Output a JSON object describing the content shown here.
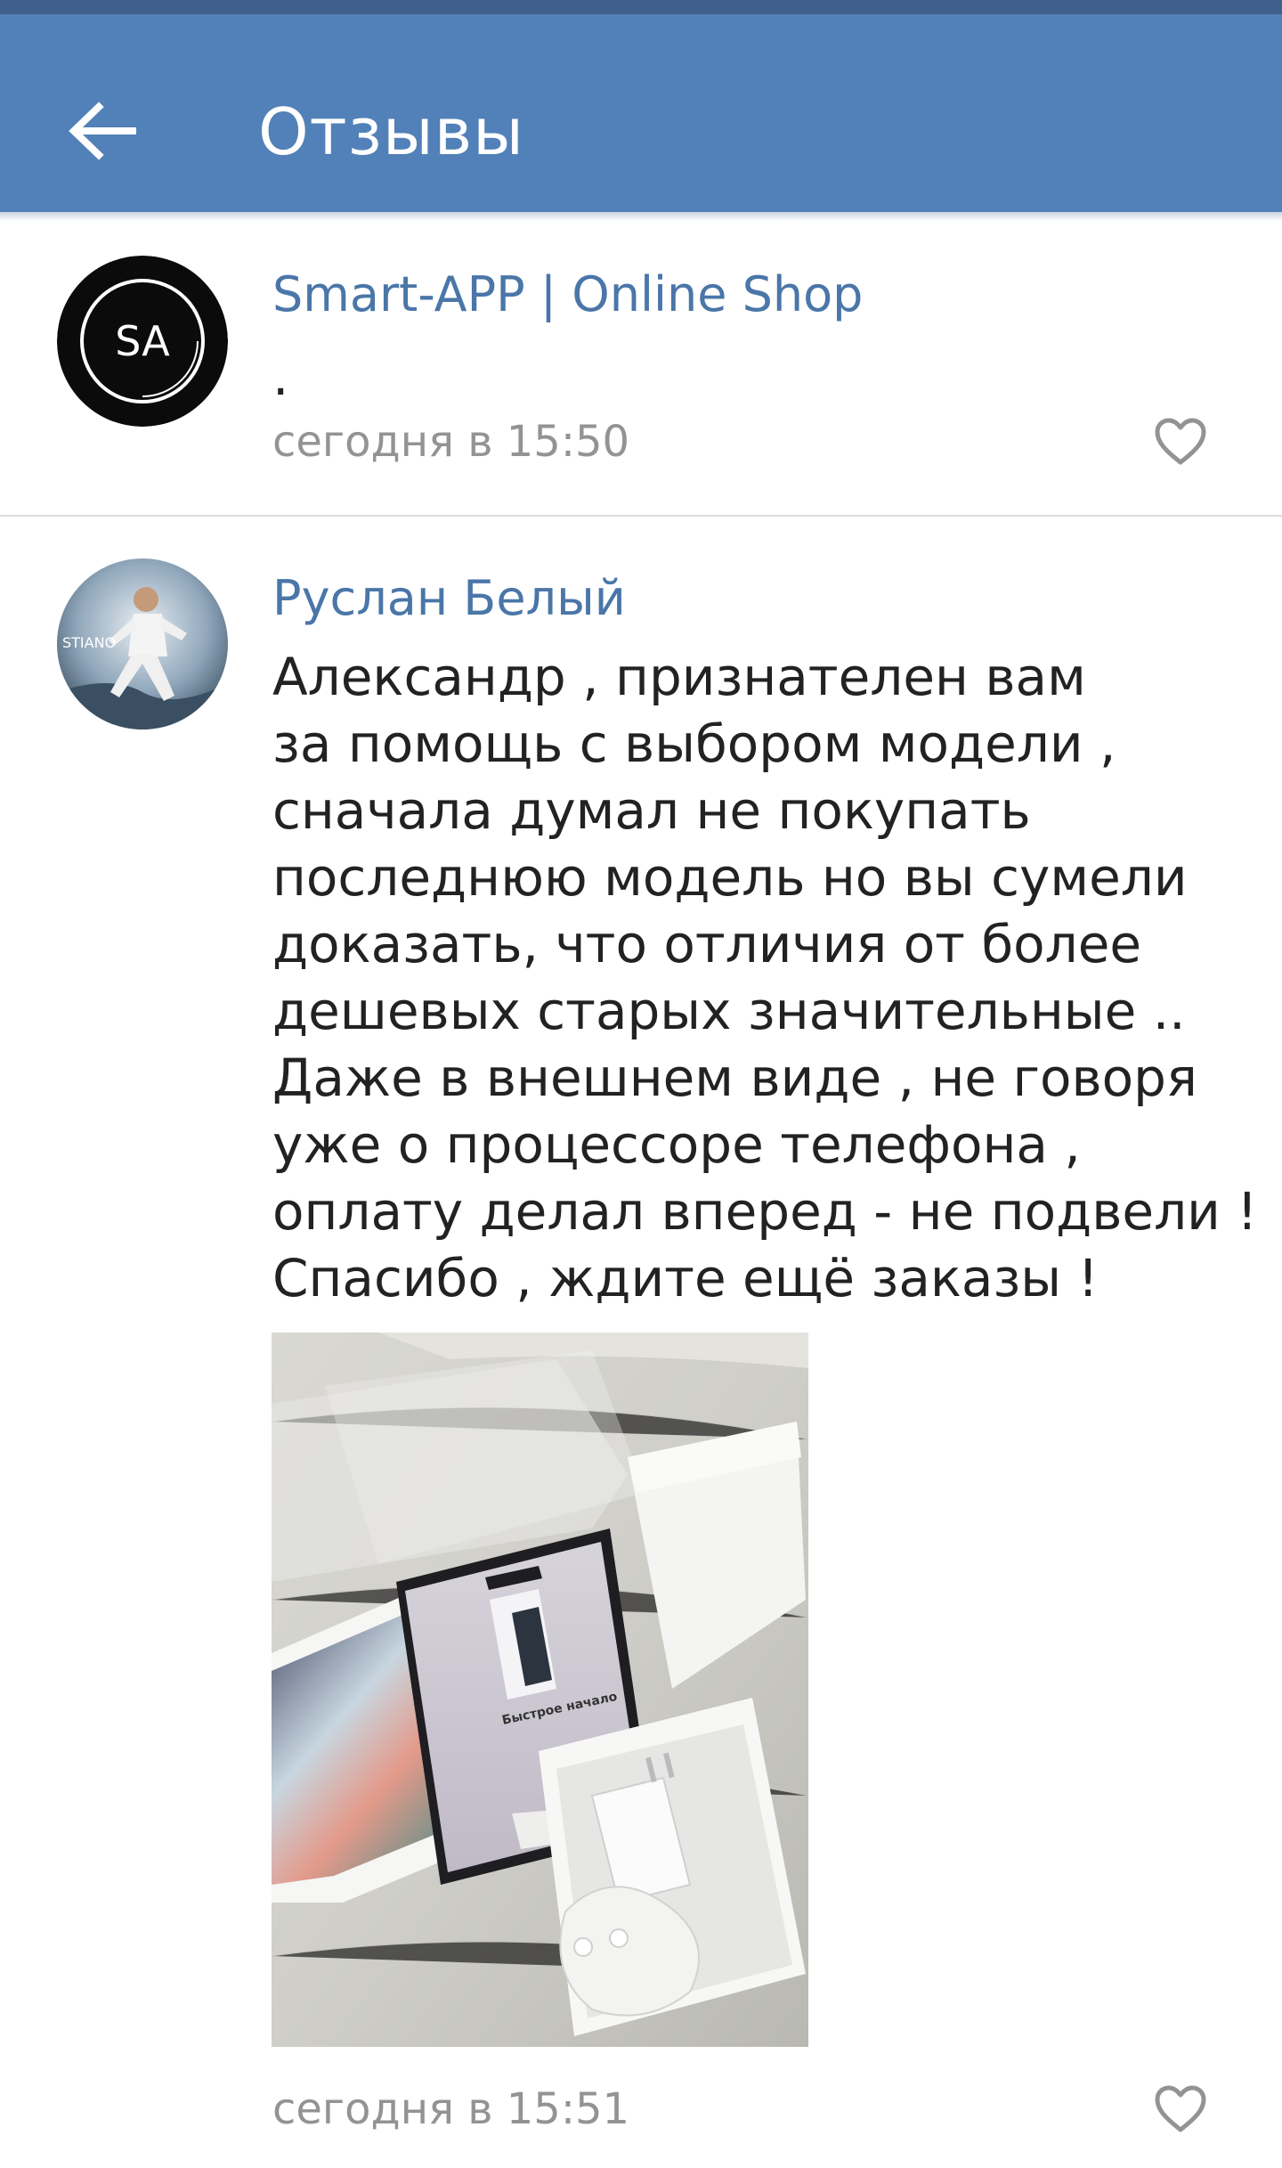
{
  "header": {
    "title": "Отзывы",
    "back_icon": "arrow-left-icon",
    "bar_color": "#5181b8"
  },
  "comments": [
    {
      "author": "Smart-APP | Online Shop",
      "avatar_text": "SA",
      "text": ".",
      "timestamp": "сегодня в 15:50",
      "like_icon": "heart-outline-icon"
    },
    {
      "author": "Руслан Белый",
      "text_lines": [
        "Александр , признателен вам",
        "за помощь с выбором модели ,",
        "сначала думал не покупать",
        "последнюю модель но вы сумели",
        "доказать, что отличия от более",
        "дешевых старых значительные ..",
        "Даже в внешнем виде , не говоря",
        "уже о процессоре телефона ,",
        "оплату делал вперед - не подвели !",
        "Спасибо , ждите ещё заказы !"
      ],
      "photo_screen_title": "Быстрое начало",
      "timestamp": "сегодня в 15:51",
      "like_icon": "heart-outline-icon"
    }
  ],
  "colors": {
    "link": "#4a76a8",
    "secondary_text": "#939393",
    "primary_text": "#222222"
  }
}
